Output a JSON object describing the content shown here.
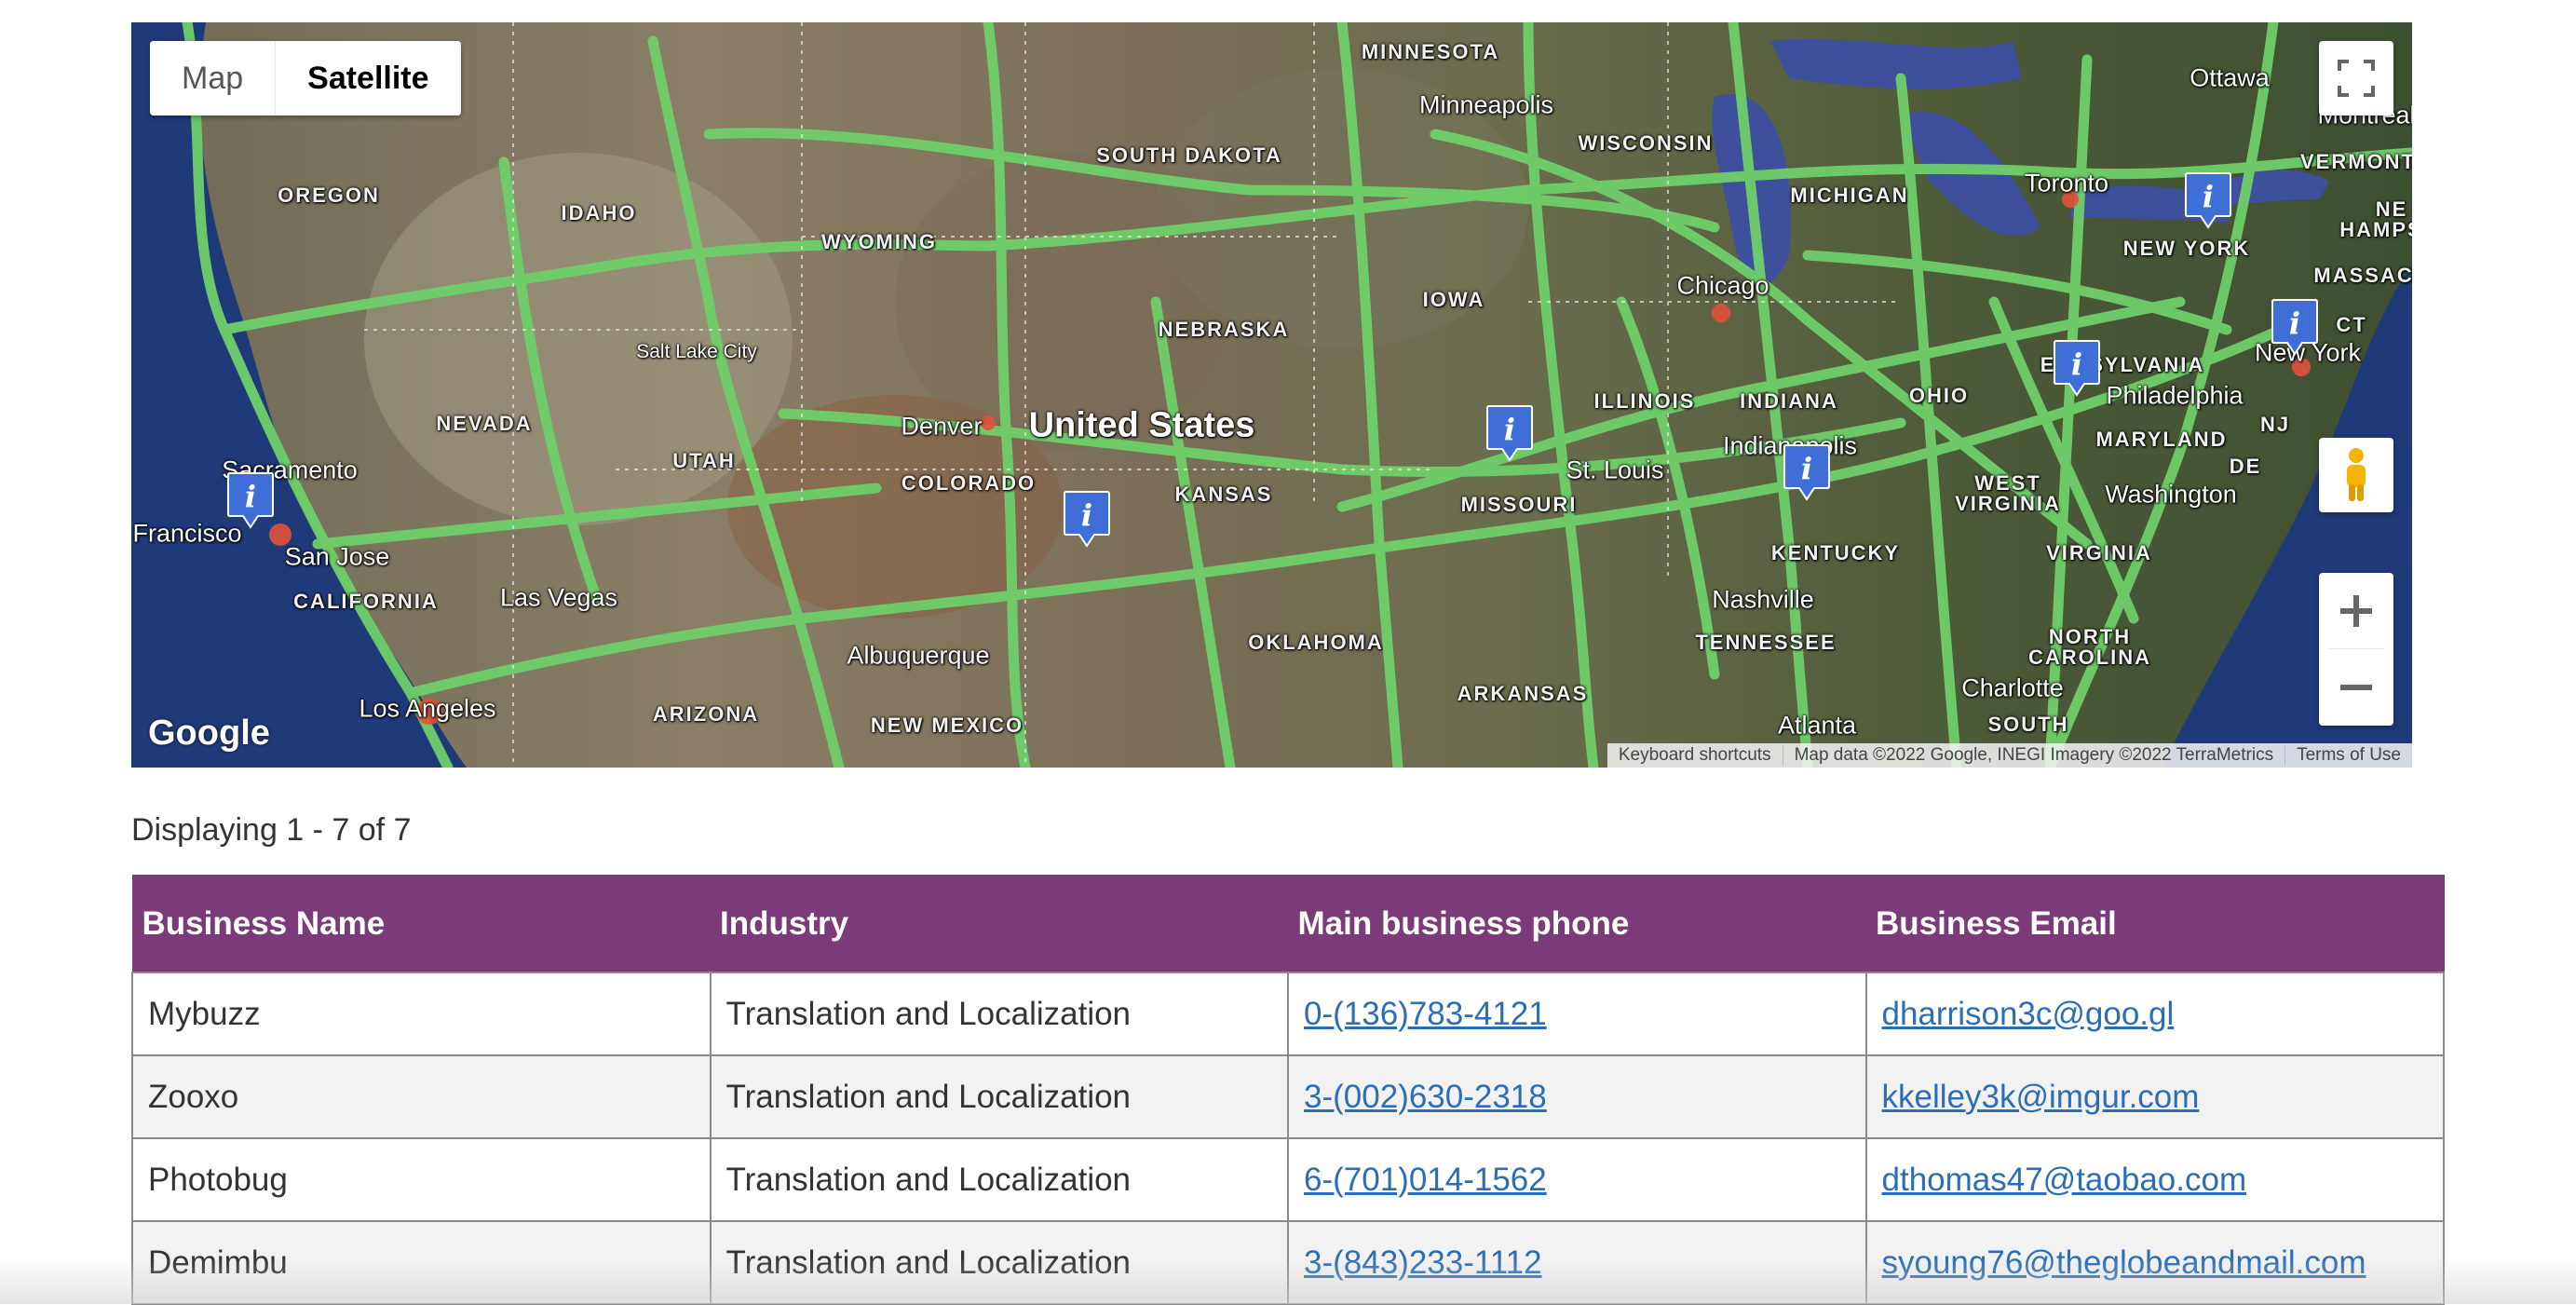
{
  "map": {
    "type_control": {
      "map_label": "Map",
      "satellite_label": "Satellite",
      "selected": "Satellite"
    },
    "country_label": "United States",
    "state_labels": [
      "MINNESOTA",
      "SOUTH DAKOTA",
      "OREGON",
      "IDAHO",
      "WYOMING",
      "NEBRASKA",
      "WISCONSIN",
      "MICHIGAN",
      "IOWA",
      "NEVADA",
      "UTAH",
      "COLORADO",
      "KANSAS",
      "MISSOURI",
      "ILLINOIS",
      "INDIANA",
      "OHIO",
      "ENNSYLVANIA",
      "MARYLAND",
      "NJ",
      "DE",
      "WEST",
      "VIRGINIA",
      "VIRGINIA",
      "KENTUCKY",
      "CALIFORNIA",
      "ARIZONA",
      "NEW MEXICO",
      "OKLAHOMA",
      "ARKANSAS",
      "TENNESSEE",
      "NORTH",
      "CAROLINA",
      "SOUTH",
      "NEW YORK",
      "VERMONT",
      "NE",
      "HAMPS",
      "MASSACH",
      "CT"
    ],
    "city_labels": [
      "Minneapolis",
      "Ottawa",
      "Montreal",
      "Toronto",
      "Chicago",
      "Salt Lake City",
      "Denver",
      "Sacramento",
      "Francisco",
      "San Jose",
      "Las Vegas",
      "Los Angeles",
      "Albuquerque",
      "St. Louis",
      "Indianapolis",
      "Philadelphia",
      "New York",
      "Washington",
      "Nashville",
      "Charlotte",
      "Atlanta"
    ],
    "google_logo": "Google",
    "attribution": {
      "shortcuts": "Keyboard shortcuts",
      "data": "Map data ©2022 Google, INEGI Imagery ©2022 TerraMetrics",
      "terms": "Terms of Use"
    },
    "marker_label": "i",
    "marker_color": "#3f6fd6",
    "road_color": "#6fcf6a"
  },
  "listing": {
    "count_text": "Displaying 1 - 7 of 7",
    "header_color": "#7b3a7a",
    "columns": [
      "Business Name",
      "Industry",
      "Main business phone",
      "Business Email"
    ],
    "rows": [
      {
        "name": "Mybuzz",
        "industry": "Translation and Localization",
        "phone": "0-(136)783-4121",
        "email": "dharrison3c@goo.gl"
      },
      {
        "name": "Zooxo",
        "industry": "Translation and Localization",
        "phone": "3-(002)630-2318",
        "email": "kkelley3k@imgur.com"
      },
      {
        "name": "Photobug",
        "industry": "Translation and Localization",
        "phone": "6-(701)014-1562",
        "email": "dthomas47@taobao.com"
      },
      {
        "name": "Demimbu",
        "industry": "Translation and Localization",
        "phone": "3-(843)233-1112",
        "email": "syoung76@theglobeandmail.com"
      }
    ]
  }
}
